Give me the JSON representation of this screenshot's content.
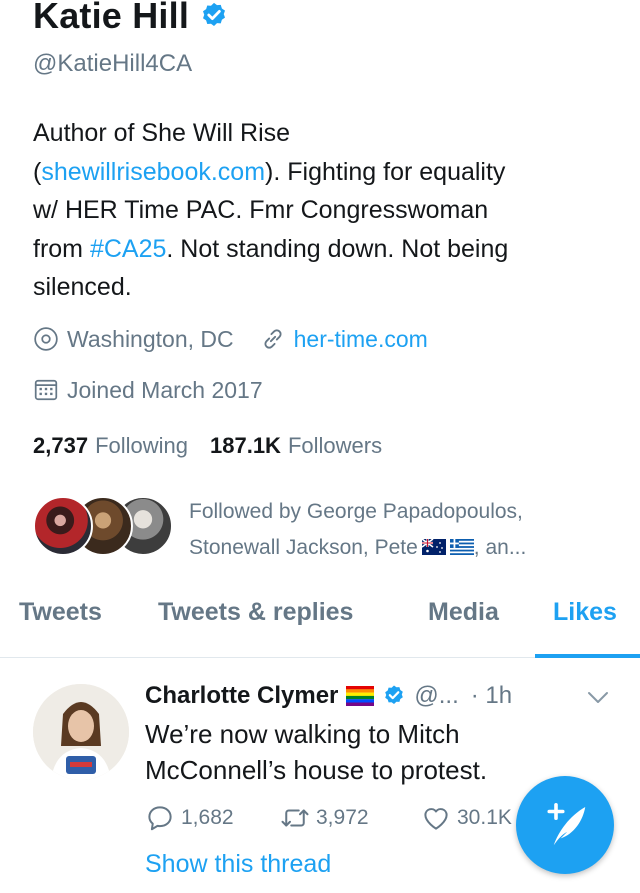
{
  "profile": {
    "display_name": "Katie Hill",
    "handle": "@KatieHill4CA",
    "bio": {
      "line1": "Author of She Will Rise",
      "line2_pre": "(",
      "line2_link": "shewillrisebook.com",
      "line2_post": "). Fighting for equality",
      "line3": "w/ HER Time PAC. Fmr Congresswoman",
      "line4_pre": "from ",
      "line4_hashtag": "#CA25",
      "line4_post": ". Not standing down. Not being",
      "line5": "silenced."
    },
    "location": "Washington, DC",
    "website": "her-time.com",
    "joined": "Joined March 2017",
    "following_count": "2,737",
    "following_label": "Following",
    "followers_count": "187.1K",
    "followers_label": "Followers",
    "followed_by_line1": "Followed by George Papadopoulos,",
    "followed_by_line2_pre": "Stonewall Jackson, Pete",
    "followed_by_line2_post": ", an..."
  },
  "tabs": [
    {
      "label": "Tweets"
    },
    {
      "label": "Tweets & replies"
    },
    {
      "label": "Media"
    },
    {
      "label": "Likes"
    }
  ],
  "tweet": {
    "author_name": "Charlotte Clymer",
    "author_handle": "@...",
    "time": "· 1h",
    "text_line1": "We’re now walking to Mitch",
    "text_line2": "McConnell’s house to protest.",
    "reply_count": "1,682",
    "retweet_count": "3,972",
    "like_count": "30.1K",
    "show_thread": "Show this thread"
  },
  "icons": {
    "verified": "verified-badge-icon",
    "location": "location-pin-icon",
    "link": "link-icon",
    "calendar": "calendar-icon",
    "reply": "reply-icon",
    "retweet": "retweet-icon",
    "like": "heart-icon",
    "compose": "compose-tweet-icon"
  },
  "colors": {
    "accent": "#1da1f2",
    "secondary_text": "#657786",
    "primary_text": "#14171a"
  }
}
